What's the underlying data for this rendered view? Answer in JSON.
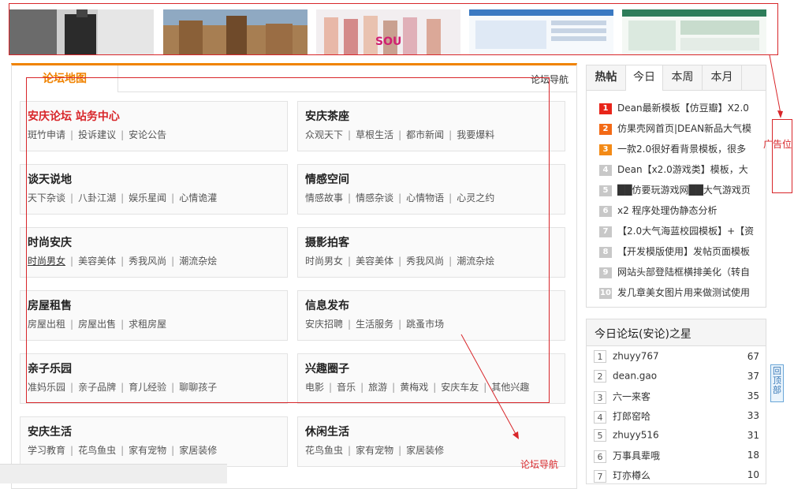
{
  "ads": {
    "images": [
      "ad-image-1",
      "ad-image-2",
      "ad-image-3",
      "ad-image-4",
      "ad-image-5"
    ]
  },
  "forum_map": {
    "tab_title": "论坛地图",
    "nav_link": "论坛导航",
    "cells": [
      {
        "title": "安庆论坛 站务中心",
        "red": true,
        "links": [
          "斑竹申请",
          "投诉建议",
          "安论公告"
        ]
      },
      {
        "title": "安庆茶座",
        "links": [
          "众观天下",
          "草根生活",
          "都市新闻",
          "我要爆料"
        ]
      },
      {
        "title": "谈天说地",
        "links": [
          "天下杂谈",
          "八卦江湖",
          "娱乐星闻",
          "心情诡灌"
        ]
      },
      {
        "title": "情感空间",
        "links": [
          "情感故事",
          "情感杂谈",
          "心情物语",
          "心灵之约"
        ]
      },
      {
        "title": "时尚安庆",
        "links": [
          "时尚男女",
          "美容美体",
          "秀我风尚",
          "潮流杂烩"
        ]
      },
      {
        "title": "摄影拍客",
        "links": [
          "时尚男女",
          "美容美体",
          "秀我风尚",
          "潮流杂烩"
        ]
      },
      {
        "title": "房屋租售",
        "links": [
          "房屋出租",
          "房屋出售",
          "求租房屋"
        ]
      },
      {
        "title": "信息发布",
        "links": [
          "安庆招聘",
          "生活服务",
          "跳蚤市场"
        ]
      },
      {
        "title": "亲子乐园",
        "links": [
          "准妈乐园",
          "亲子品牌",
          "育儿经验",
          "聊聊孩子"
        ]
      },
      {
        "title": "兴趣圈子",
        "links": [
          "电影",
          "音乐",
          "旅游",
          "黄梅戏",
          "安庆车友",
          "其他兴趣"
        ]
      },
      {
        "title": "安庆生活",
        "links": [
          "学习教育",
          "花鸟鱼虫",
          "家有宠物",
          "家居装修"
        ]
      },
      {
        "title": "休闲生活",
        "links": [
          "花鸟鱼虫",
          "家有宠物",
          "家居装修"
        ]
      }
    ]
  },
  "hot": {
    "tabs": [
      "热帖",
      "今日",
      "本周",
      "本月"
    ],
    "items": [
      {
        "n": "1",
        "text": "Dean最新模板【仿豆瓣】X2.0"
      },
      {
        "n": "2",
        "text": "仿果壳网首页|DEAN新品大气模"
      },
      {
        "n": "3",
        "text": "一款2.0很好看背景模板，很多"
      },
      {
        "n": "4",
        "text": "Dean【x2.0游戏类】模板，大"
      },
      {
        "n": "5",
        "text": "██仿要玩游戏网██大气游戏页"
      },
      {
        "n": "6",
        "text": "x2 程序处理伪静态分析"
      },
      {
        "n": "7",
        "text": "【2.0大气海蓝校园模板】+【资"
      },
      {
        "n": "8",
        "text": "【开发模版使用】发帖页面模板"
      },
      {
        "n": "9",
        "text": "网站头部登陆框横排美化（转自"
      },
      {
        "n": "10",
        "text": "发几章美女图片用来做测试使用"
      }
    ]
  },
  "stars": {
    "title": "今日论坛(安论)之星",
    "rows": [
      {
        "n": "1",
        "name": "zhuyy767",
        "score": "67"
      },
      {
        "n": "2",
        "name": "dean.gao",
        "score": "37"
      },
      {
        "n": "3",
        "name": "六一来客",
        "score": "35"
      },
      {
        "n": "4",
        "name": "打郎窑哈",
        "score": "33"
      },
      {
        "n": "5",
        "name": "zhuyy516",
        "score": "31"
      },
      {
        "n": "6",
        "name": "万事具辈哦",
        "score": "18"
      },
      {
        "n": "7",
        "name": "玎亦樽么",
        "score": "10"
      }
    ]
  },
  "annotations": {
    "ad_label": "广告位",
    "nav_label": "论坛导航",
    "top_button": "回顶部"
  }
}
